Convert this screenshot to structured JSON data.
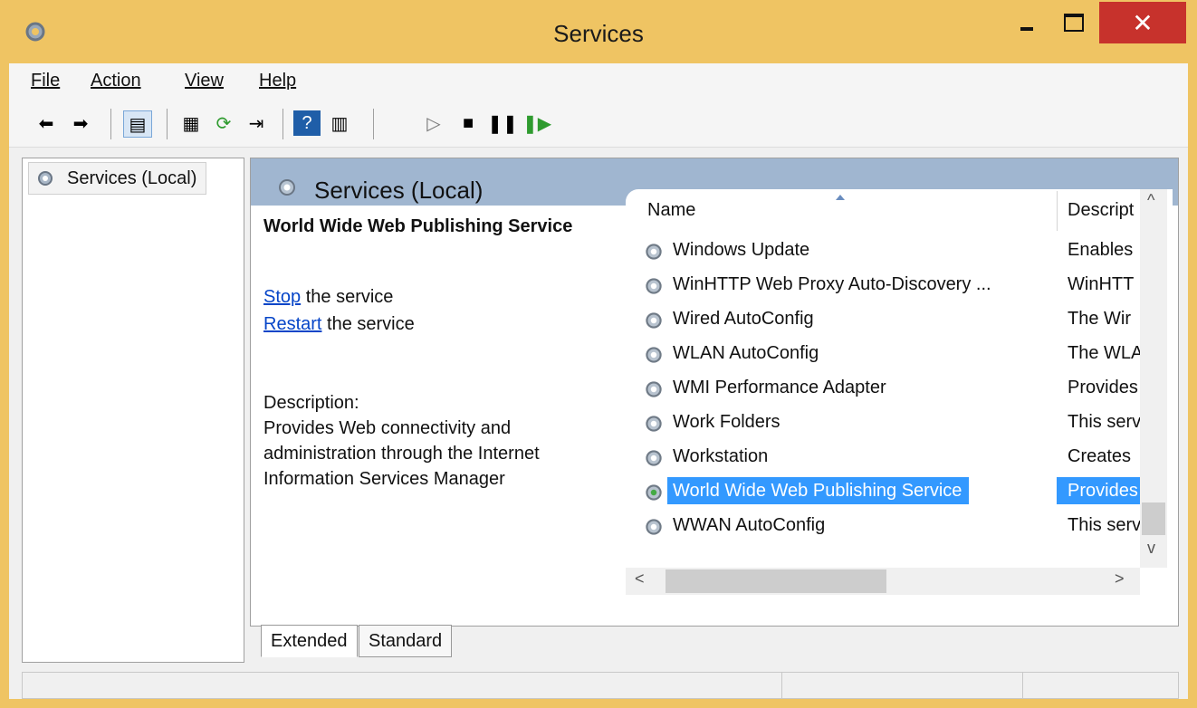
{
  "window": {
    "title": "Services"
  },
  "menu": {
    "items": [
      "File",
      "Action",
      "View",
      "Help"
    ]
  },
  "tree": {
    "root": "Services (Local)"
  },
  "content": {
    "header_title": "Services (Local)",
    "selected_service": "World Wide Web Publishing Service",
    "stop_link": "Stop",
    "stop_suffix": " the service",
    "restart_link": "Restart",
    "restart_suffix": " the service",
    "description_label": "Description:",
    "description_text": "Provides Web connectivity and administration through the Internet Information Services Manager"
  },
  "table": {
    "columns": [
      {
        "label": "Name"
      },
      {
        "label": "Descript"
      }
    ],
    "rows": [
      {
        "name": "Windows Update",
        "desc": "Enables"
      },
      {
        "name": "WinHTTP Web Proxy Auto-Discovery ...",
        "desc": "WinHTT"
      },
      {
        "name": "Wired AutoConfig",
        "desc": "The Wir"
      },
      {
        "name": "WLAN AutoConfig",
        "desc": "The WLA"
      },
      {
        "name": "WMI Performance Adapter",
        "desc": "Provides"
      },
      {
        "name": "Work Folders",
        "desc": "This serv"
      },
      {
        "name": "Workstation",
        "desc": "Creates"
      },
      {
        "name": "World Wide Web Publishing Service",
        "desc": "Provides",
        "selected": true
      },
      {
        "name": "WWAN AutoConfig",
        "desc": "This serv"
      }
    ]
  },
  "tabs": {
    "extended": "Extended",
    "standard": "Standard"
  },
  "colors": {
    "accent": "#efc463",
    "selection": "#3399ff",
    "header": "#a0b6d0",
    "close": "#c7322c"
  },
  "icons": [
    "services-gear-icon",
    "back-arrow-icon",
    "forward-arrow-icon",
    "console-tree-icon",
    "properties-icon",
    "refresh-icon",
    "export-icon",
    "help-icon",
    "show-hide-icon",
    "play-icon",
    "stop-icon",
    "pause-icon",
    "resume-icon"
  ]
}
